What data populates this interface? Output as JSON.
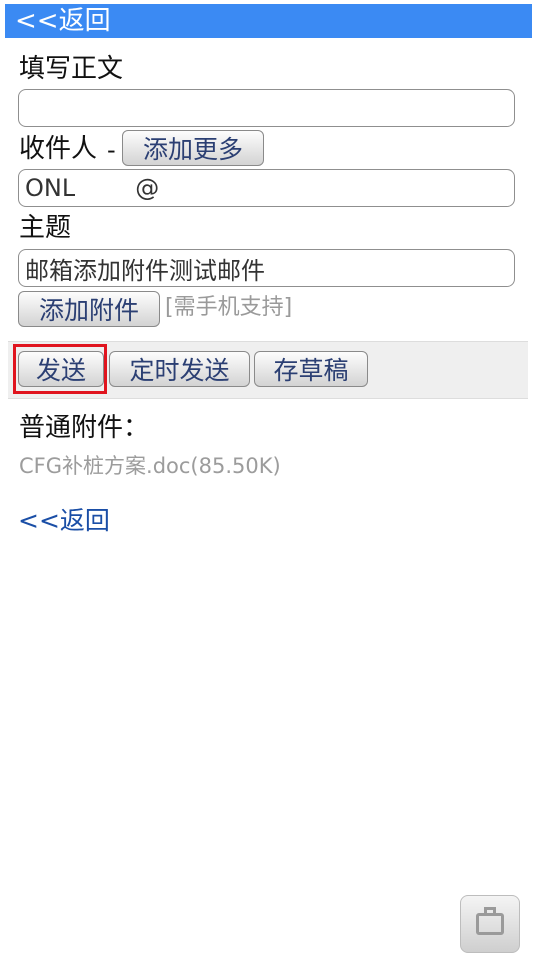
{
  "topbar": {
    "back_label": "<<返回"
  },
  "body_section": {
    "label": "填写正文",
    "value": ""
  },
  "recipient_section": {
    "label": "收件人",
    "separator": "-",
    "add_more_label": "添加更多",
    "value_prefix": "ONL",
    "value_suffix": "@"
  },
  "subject_section": {
    "label": "主题",
    "value": "邮箱添加附件测试邮件"
  },
  "attachment_controls": {
    "add_attachment_label": "添加附件",
    "hint": "[需手机支持]"
  },
  "actions": {
    "send_label": "发送",
    "timed_send_label": "定时发送",
    "save_draft_label": "存草稿"
  },
  "attachments": {
    "title": "普通附件：",
    "files": [
      {
        "name": "CFG补桩方案.doc(85.50K)"
      }
    ]
  },
  "footer": {
    "back_label": "<<返回"
  },
  "colors": {
    "topbar": "#3b8af3",
    "highlight": "#e0141e",
    "link": "#1a4ea6"
  }
}
